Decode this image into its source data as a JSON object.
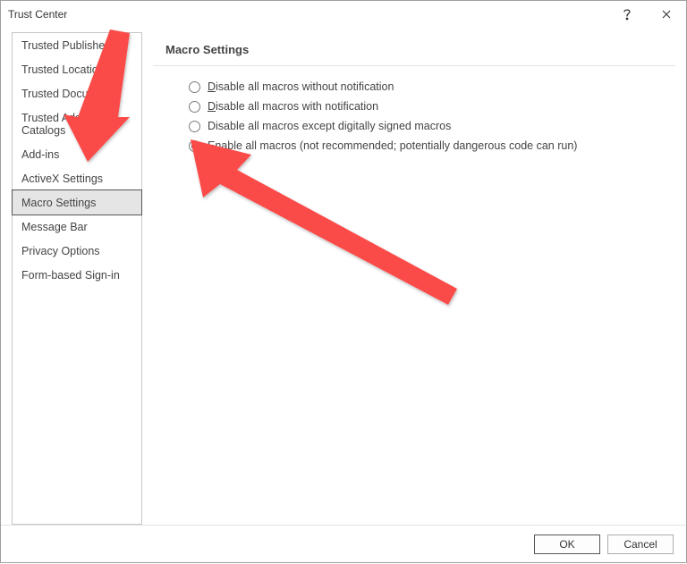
{
  "window": {
    "title": "Trust Center"
  },
  "sidebar": {
    "items": [
      {
        "label": "Trusted Publishers"
      },
      {
        "label": "Trusted Locations"
      },
      {
        "label": "Trusted Documents"
      },
      {
        "label": "Trusted Add-in Catalogs"
      },
      {
        "label": "Add-ins"
      },
      {
        "label": "ActiveX Settings"
      },
      {
        "label": "Macro Settings"
      },
      {
        "label": "Message Bar"
      },
      {
        "label": "Privacy Options"
      },
      {
        "label": "Form-based Sign-in"
      }
    ],
    "selected_index": 6
  },
  "main": {
    "section_title": "Macro Settings",
    "macro_options": [
      {
        "label": "Disable all macros without notification",
        "selected": false
      },
      {
        "label": "Disable all macros with notification",
        "selected": false
      },
      {
        "label": "Disable all macros except digitally signed macros",
        "selected": false
      },
      {
        "label": "Enable all macros (not recommended; potentially dangerous code can run)",
        "selected": true
      }
    ]
  },
  "footer": {
    "ok": "OK",
    "cancel": "Cancel"
  },
  "annotation": {
    "color": "#fb4b4a"
  }
}
